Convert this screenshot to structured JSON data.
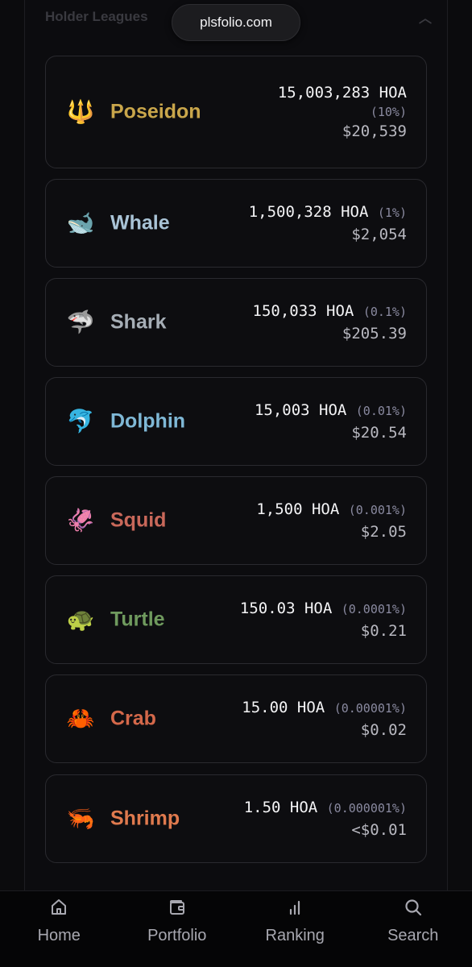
{
  "browser": {
    "url": "plsfolio.com"
  },
  "section": {
    "title": "Holder Leagues"
  },
  "leagues": [
    {
      "emoji": "🔱",
      "name": "Poseidon",
      "color": "#c9a64b",
      "amount": "15,003,283 HOA",
      "pct": "(10%)",
      "usd": "$20,539"
    },
    {
      "emoji": "🐋",
      "name": "Whale",
      "color": "#a9c3d6",
      "amount": "1,500,328 HOA",
      "pct": "(1%)",
      "usd": "$2,054"
    },
    {
      "emoji": "🦈",
      "name": "Shark",
      "color": "#a6aeb6",
      "amount": "150,033 HOA",
      "pct": "(0.1%)",
      "usd": "$205.39"
    },
    {
      "emoji": "🐬",
      "name": "Dolphin",
      "color": "#7fb8d6",
      "amount": "15,003 HOA",
      "pct": "(0.01%)",
      "usd": "$20.54"
    },
    {
      "emoji": "🦑",
      "name": "Squid",
      "color": "#c9685a",
      "amount": "1,500 HOA",
      "pct": "(0.001%)",
      "usd": "$2.05"
    },
    {
      "emoji": "🐢",
      "name": "Turtle",
      "color": "#6f9a5e",
      "amount": "150.03 HOA",
      "pct": "(0.0001%)",
      "usd": "$0.21"
    },
    {
      "emoji": "🦀",
      "name": "Crab",
      "color": "#d4684a",
      "amount": "15.00 HOA",
      "pct": "(0.00001%)",
      "usd": "$0.02"
    },
    {
      "emoji": "🦐",
      "name": "Shrimp",
      "color": "#e07a4e",
      "amount": "1.50 HOA",
      "pct": "(0.000001%)",
      "usd": "<$0.01"
    }
  ],
  "nav": {
    "home": "Home",
    "portfolio": "Portfolio",
    "ranking": "Ranking",
    "search": "Search"
  }
}
